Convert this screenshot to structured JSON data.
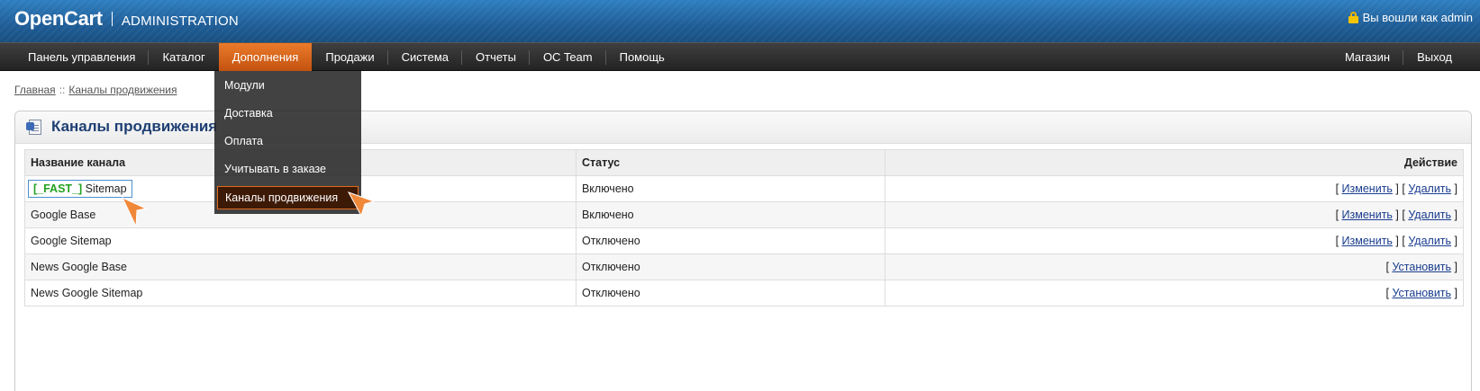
{
  "header": {
    "logo": "OpenCart",
    "subtitle": "ADMINISTRATION",
    "logged_in": "Вы вошли как admin",
    "lock_icon": "lock-icon"
  },
  "menu": {
    "left": [
      "Панель управления",
      "Каталог",
      "Дополнения",
      "Продажи",
      "Система",
      "Отчеты",
      "OC Team",
      "Помощь"
    ],
    "active": "Дополнения",
    "right": [
      "Магазин",
      "Выход"
    ]
  },
  "dropdown": {
    "items": [
      "Модули",
      "Доставка",
      "Оплата",
      "Учитывать в заказе",
      "Каналы продвижения"
    ],
    "selected": "Каналы продвижения"
  },
  "breadcrumb": {
    "home": "Главная",
    "separator": "::",
    "current": "Каналы продвижения"
  },
  "box": {
    "title": "Каналы продвижения"
  },
  "table": {
    "headers": {
      "name": "Название канала",
      "status": "Статус",
      "action": "Действие"
    },
    "rows": [
      {
        "prefix": "[_FAST_]",
        "name": "Sitemap",
        "status": "Включено",
        "actions": [
          "Изменить",
          "Удалить"
        ]
      },
      {
        "prefix": "",
        "name": "Google Base",
        "status": "Включено",
        "actions": [
          "Изменить",
          "Удалить"
        ]
      },
      {
        "prefix": "",
        "name": "Google Sitemap",
        "status": "Отключено",
        "actions": [
          "Изменить",
          "Удалить"
        ]
      },
      {
        "prefix": "",
        "name": "News Google Base",
        "status": "Отключено",
        "actions": [
          "Установить"
        ]
      },
      {
        "prefix": "",
        "name": "News Google Sitemap",
        "status": "Отключено",
        "actions": [
          "Установить"
        ]
      }
    ]
  },
  "colors": {
    "header_blue": "#1f5d97",
    "menu_dark": "#2a2a2a",
    "active_orange": "#d8621a",
    "fast_green": "#22a11f",
    "arrow_orange": "#f0883a",
    "title_blue": "#1e3f73"
  }
}
